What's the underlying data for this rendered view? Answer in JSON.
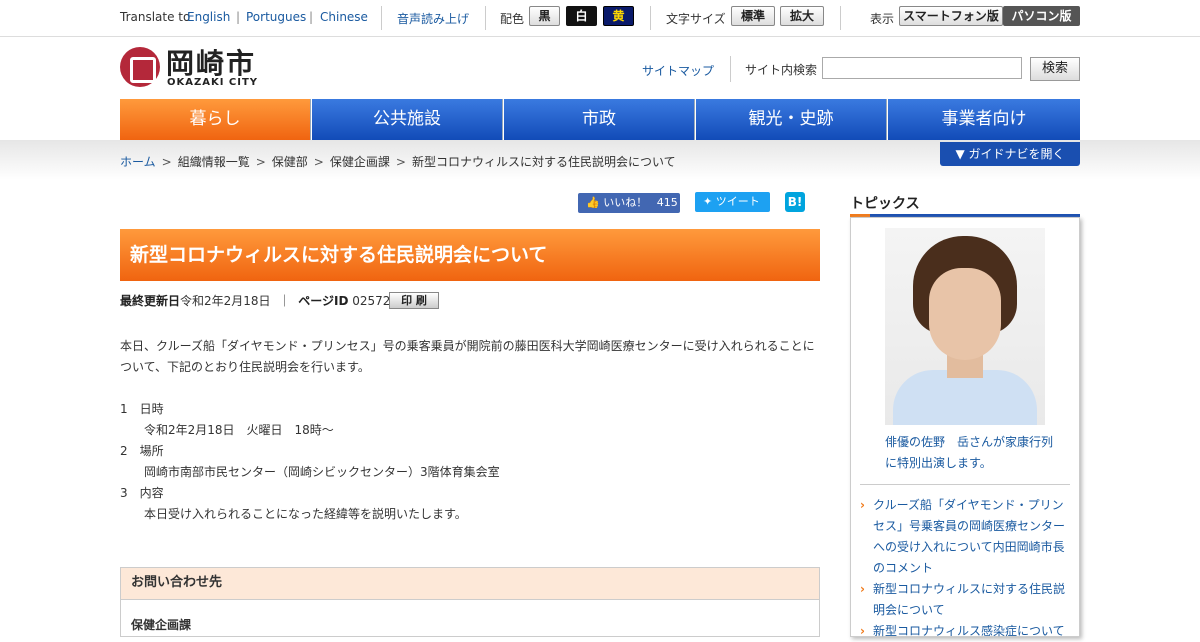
{
  "utility": {
    "translate_label": "Translate to",
    "languages": [
      "English",
      "Portugues",
      "Chinese"
    ],
    "lang_sep": "|",
    "voice": "音声読み上げ",
    "color_label": "配色",
    "colors": [
      "黒",
      "白",
      "黄"
    ],
    "font_label": "文字サイズ",
    "font_options": [
      "標準",
      "拡大"
    ],
    "display_label": "表示",
    "display_options": [
      "スマートフォン版",
      "パソコン版"
    ]
  },
  "header": {
    "logo_jp": "岡崎市",
    "logo_en": "OKAZAKI CITY",
    "sitemap": "サイトマップ",
    "search_label": "サイト内検索",
    "search_value": "",
    "search_button": "検索"
  },
  "gnav": [
    "暮らし",
    "公共施設",
    "市政",
    "観光・史跡",
    "事業者向け"
  ],
  "breadcrumb": [
    "ホーム",
    "組織情報一覧",
    "保健部",
    "保健企画課",
    "新型コロナウィルスに対する住民説明会について"
  ],
  "breadcrumb_sep": ">",
  "guide_button": "▼ ガイドナビを開く",
  "social": {
    "like_label": "いいね！",
    "like_count": "415",
    "tweet": "ツイート",
    "hatena": "B!"
  },
  "article": {
    "title": "新型コロナウィルスに対する住民説明会について",
    "updated_label": "最終更新日",
    "updated_value": "令和2年2月18日",
    "meta_sep": "｜",
    "pageid_label": "ページID",
    "pageid_value": "025722",
    "print": "印 刷",
    "intro": "本日、クルーズ船「ダイヤモンド・プリンセス」号の乗客乗員が開院前の藤田医科大学岡崎医療センターに受け入れられることについて、下記のとおり住民説明会を行います。",
    "items": [
      {
        "heading": "1　日時",
        "detail": "令和2年2月18日　火曜日　18時～"
      },
      {
        "heading": "2　場所",
        "detail": "岡崎市南部市民センター（岡崎シビックセンター）3階体育集会室"
      },
      {
        "heading": "3　内容",
        "detail": "本日受け入れられることになった経緯等を説明いたします。"
      }
    ]
  },
  "contact": {
    "heading": "お問い合わせ先",
    "department": "保健企画課"
  },
  "topics": {
    "heading": "トピックス",
    "photo_caption": "俳優の佐野　岳さんが家康行列に特別出演します。",
    "items": [
      "クルーズ船「ダイヤモンド・プリンセス」号乗客員の岡崎医療センターへの受け入れについて内田岡崎市長のコメント",
      "新型コロナウィルスに対する住民説明会について",
      "新型コロナウィルス感染症について"
    ]
  },
  "colors": {
    "nav_blue": "#124bb8",
    "nav_orange": "#f06410",
    "link": "#1a5aa0"
  }
}
